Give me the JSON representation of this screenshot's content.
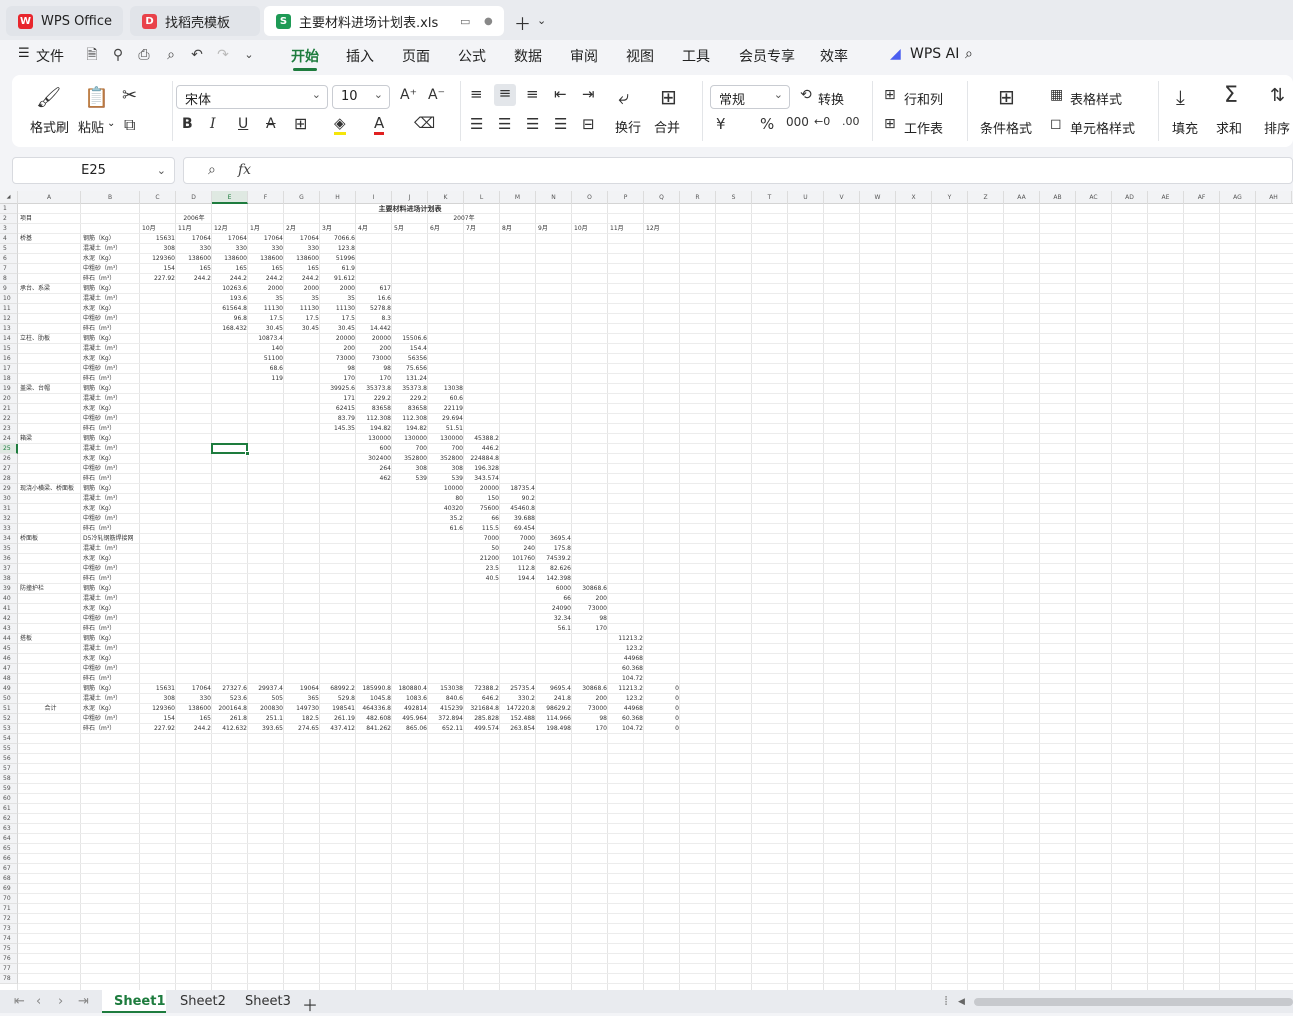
{
  "tabs": {
    "wps": "WPS Office",
    "templates": "找稻壳模板",
    "file": "主要材料进场计划表.xls"
  },
  "menu": {
    "file": "文件",
    "items": [
      "开始",
      "插入",
      "页面",
      "公式",
      "数据",
      "审阅",
      "视图",
      "工具",
      "会员专享",
      "效率"
    ],
    "ai": "WPS AI"
  },
  "ribbon": {
    "format_painter": "格式刷",
    "paste": "粘贴",
    "font": "宋体",
    "size": "10",
    "wrap": "换行",
    "merge": "合并",
    "numfmt": "常规",
    "convert": "转换",
    "rowcol": "行和列",
    "worksheet": "工作表",
    "condfmt": "条件格式",
    "tablestyle": "表格样式",
    "cellstyle": "单元格样式",
    "fill": "填充",
    "sum": "求和",
    "sort": "排序"
  },
  "namebox": "E25",
  "fx": "fx",
  "cols": [
    "A",
    "B",
    "C",
    "D",
    "E",
    "F",
    "G",
    "H",
    "I",
    "J",
    "K",
    "L",
    "M",
    "N",
    "O",
    "P",
    "Q",
    "R",
    "S",
    "T",
    "U",
    "V",
    "W",
    "X",
    "Y",
    "Z",
    "AA",
    "AB",
    "AC",
    "AD",
    "AE",
    "AF",
    "AG",
    "AH"
  ],
  "sheet_title": "主要材料进场计划表",
  "year_headers": [
    "2006年",
    "2007年"
  ],
  "month_headers": [
    "10月",
    "11月",
    "12月",
    "1月",
    "2月",
    "3月",
    "4月",
    "5月",
    "6月",
    "7月",
    "8月",
    "9月",
    "10月",
    "11月",
    "12月"
  ],
  "cells": [
    [
      2,
      "A",
      "项目"
    ],
    [
      4,
      "A",
      "桥基"
    ],
    [
      4,
      "B",
      "钢筋（Kg）"
    ],
    [
      4,
      "C",
      "15631"
    ],
    [
      4,
      "D",
      "17064"
    ],
    [
      4,
      "E",
      "17064"
    ],
    [
      4,
      "F",
      "17064"
    ],
    [
      4,
      "G",
      "17064"
    ],
    [
      4,
      "H",
      "7066.6"
    ],
    [
      5,
      "B",
      "混凝土（m³）"
    ],
    [
      5,
      "C",
      "308"
    ],
    [
      5,
      "D",
      "330"
    ],
    [
      5,
      "E",
      "330"
    ],
    [
      5,
      "F",
      "330"
    ],
    [
      5,
      "G",
      "330"
    ],
    [
      5,
      "H",
      "123.8"
    ],
    [
      6,
      "B",
      "水泥（Kg）"
    ],
    [
      6,
      "C",
      "129360"
    ],
    [
      6,
      "D",
      "138600"
    ],
    [
      6,
      "E",
      "138600"
    ],
    [
      6,
      "F",
      "138600"
    ],
    [
      6,
      "G",
      "138600"
    ],
    [
      6,
      "H",
      "51996"
    ],
    [
      7,
      "B",
      "中粗砂（m³）"
    ],
    [
      7,
      "C",
      "154"
    ],
    [
      7,
      "D",
      "165"
    ],
    [
      7,
      "E",
      "165"
    ],
    [
      7,
      "F",
      "165"
    ],
    [
      7,
      "G",
      "165"
    ],
    [
      7,
      "H",
      "61.9"
    ],
    [
      8,
      "B",
      "碎石（m³）"
    ],
    [
      8,
      "C",
      "227.92"
    ],
    [
      8,
      "D",
      "244.2"
    ],
    [
      8,
      "E",
      "244.2"
    ],
    [
      8,
      "F",
      "244.2"
    ],
    [
      8,
      "G",
      "244.2"
    ],
    [
      8,
      "H",
      "91.612"
    ],
    [
      9,
      "A",
      "承台、系梁"
    ],
    [
      9,
      "B",
      "钢筋（Kg）"
    ],
    [
      9,
      "E",
      "10263.6"
    ],
    [
      9,
      "F",
      "2000"
    ],
    [
      9,
      "G",
      "2000"
    ],
    [
      9,
      "H",
      "2000"
    ],
    [
      9,
      "I",
      "617"
    ],
    [
      10,
      "B",
      "混凝土（m³）"
    ],
    [
      10,
      "E",
      "193.6"
    ],
    [
      10,
      "F",
      "35"
    ],
    [
      10,
      "G",
      "35"
    ],
    [
      10,
      "H",
      "35"
    ],
    [
      10,
      "I",
      "16.6"
    ],
    [
      11,
      "B",
      "水泥（Kg）"
    ],
    [
      11,
      "E",
      "61564.8"
    ],
    [
      11,
      "F",
      "11130"
    ],
    [
      11,
      "G",
      "11130"
    ],
    [
      11,
      "H",
      "11130"
    ],
    [
      11,
      "I",
      "5278.8"
    ],
    [
      12,
      "B",
      "中粗砂（m³）"
    ],
    [
      12,
      "E",
      "96.8"
    ],
    [
      12,
      "F",
      "17.5"
    ],
    [
      12,
      "G",
      "17.5"
    ],
    [
      12,
      "H",
      "17.5"
    ],
    [
      12,
      "I",
      "8.3"
    ],
    [
      13,
      "B",
      "碎石（m³）"
    ],
    [
      13,
      "E",
      "168.432"
    ],
    [
      13,
      "F",
      "30.45"
    ],
    [
      13,
      "G",
      "30.45"
    ],
    [
      13,
      "H",
      "30.45"
    ],
    [
      13,
      "I",
      "14.442"
    ],
    [
      14,
      "A",
      "立柱、肋板"
    ],
    [
      14,
      "B",
      "钢筋（Kg）"
    ],
    [
      14,
      "F",
      "10873.4"
    ],
    [
      14,
      "H",
      "20000"
    ],
    [
      14,
      "I",
      "20000"
    ],
    [
      14,
      "J",
      "15506.6"
    ],
    [
      15,
      "B",
      "混凝土（m³）"
    ],
    [
      15,
      "F",
      "140"
    ],
    [
      15,
      "H",
      "200"
    ],
    [
      15,
      "I",
      "200"
    ],
    [
      15,
      "J",
      "154.4"
    ],
    [
      16,
      "B",
      "水泥（Kg）"
    ],
    [
      16,
      "F",
      "51100"
    ],
    [
      16,
      "H",
      "73000"
    ],
    [
      16,
      "I",
      "73000"
    ],
    [
      16,
      "J",
      "56356"
    ],
    [
      17,
      "B",
      "中粗砂（m³）"
    ],
    [
      17,
      "F",
      "68.6"
    ],
    [
      17,
      "H",
      "98"
    ],
    [
      17,
      "I",
      "98"
    ],
    [
      17,
      "J",
      "75.656"
    ],
    [
      18,
      "B",
      "碎石（m³）"
    ],
    [
      18,
      "F",
      "119"
    ],
    [
      18,
      "H",
      "170"
    ],
    [
      18,
      "I",
      "170"
    ],
    [
      18,
      "J",
      "131.24"
    ],
    [
      19,
      "A",
      "盖梁、台帽"
    ],
    [
      19,
      "B",
      "钢筋（Kg）"
    ],
    [
      19,
      "H",
      "39925.6"
    ],
    [
      19,
      "I",
      "35373.8"
    ],
    [
      19,
      "J",
      "35373.8"
    ],
    [
      19,
      "K",
      "13038"
    ],
    [
      20,
      "B",
      "混凝土（m³）"
    ],
    [
      20,
      "H",
      "171"
    ],
    [
      20,
      "I",
      "229.2"
    ],
    [
      20,
      "J",
      "229.2"
    ],
    [
      20,
      "K",
      "60.6"
    ],
    [
      21,
      "B",
      "水泥（Kg）"
    ],
    [
      21,
      "H",
      "62415"
    ],
    [
      21,
      "I",
      "83658"
    ],
    [
      21,
      "J",
      "83658"
    ],
    [
      21,
      "K",
      "22119"
    ],
    [
      22,
      "B",
      "中粗砂（m³）"
    ],
    [
      22,
      "H",
      "83.79"
    ],
    [
      22,
      "I",
      "112.308"
    ],
    [
      22,
      "J",
      "112.308"
    ],
    [
      22,
      "K",
      "29.694"
    ],
    [
      23,
      "B",
      "碎石（m³）"
    ],
    [
      23,
      "H",
      "145.35"
    ],
    [
      23,
      "I",
      "194.82"
    ],
    [
      23,
      "J",
      "194.82"
    ],
    [
      23,
      "K",
      "51.51"
    ],
    [
      24,
      "A",
      "箱梁"
    ],
    [
      24,
      "B",
      "钢筋（Kg）"
    ],
    [
      24,
      "I",
      "130000"
    ],
    [
      24,
      "J",
      "130000"
    ],
    [
      24,
      "K",
      "130000"
    ],
    [
      24,
      "L",
      "45388.2"
    ],
    [
      25,
      "B",
      "混凝土（m³）"
    ],
    [
      25,
      "I",
      "600"
    ],
    [
      25,
      "J",
      "700"
    ],
    [
      25,
      "K",
      "700"
    ],
    [
      25,
      "L",
      "446.2"
    ],
    [
      26,
      "B",
      "水泥（Kg）"
    ],
    [
      26,
      "I",
      "302400"
    ],
    [
      26,
      "J",
      "352800"
    ],
    [
      26,
      "K",
      "352800"
    ],
    [
      26,
      "L",
      "224884.8"
    ],
    [
      27,
      "B",
      "中粗砂（m³）"
    ],
    [
      27,
      "I",
      "264"
    ],
    [
      27,
      "J",
      "308"
    ],
    [
      27,
      "K",
      "308"
    ],
    [
      27,
      "L",
      "196.328"
    ],
    [
      28,
      "B",
      "碎石（m³）"
    ],
    [
      28,
      "I",
      "462"
    ],
    [
      28,
      "J",
      "539"
    ],
    [
      28,
      "K",
      "539"
    ],
    [
      28,
      "L",
      "343.574"
    ],
    [
      29,
      "A",
      "现浇小横梁、桥面板"
    ],
    [
      29,
      "B",
      "钢筋（Kg）"
    ],
    [
      29,
      "K",
      "10000"
    ],
    [
      29,
      "L",
      "20000"
    ],
    [
      29,
      "M",
      "18735.4"
    ],
    [
      30,
      "B",
      "混凝土（m³）"
    ],
    [
      30,
      "K",
      "80"
    ],
    [
      30,
      "L",
      "150"
    ],
    [
      30,
      "M",
      "90.2"
    ],
    [
      31,
      "B",
      "水泥（Kg）"
    ],
    [
      31,
      "K",
      "40320"
    ],
    [
      31,
      "L",
      "75600"
    ],
    [
      31,
      "M",
      "45460.8"
    ],
    [
      32,
      "B",
      "中粗砂（m³）"
    ],
    [
      32,
      "K",
      "35.2"
    ],
    [
      32,
      "L",
      "66"
    ],
    [
      32,
      "M",
      "39.688"
    ],
    [
      33,
      "B",
      "碎石（m³）"
    ],
    [
      33,
      "K",
      "61.6"
    ],
    [
      33,
      "L",
      "115.5"
    ],
    [
      33,
      "M",
      "69.454"
    ],
    [
      34,
      "A",
      "桥面板"
    ],
    [
      34,
      "B",
      "D5冷轧钢筋焊接网"
    ],
    [
      34,
      "L",
      "7000"
    ],
    [
      34,
      "M",
      "7000"
    ],
    [
      34,
      "N",
      "3695.4"
    ],
    [
      35,
      "B",
      "混凝土（m³）"
    ],
    [
      35,
      "L",
      "50"
    ],
    [
      35,
      "M",
      "240"
    ],
    [
      35,
      "N",
      "175.8"
    ],
    [
      36,
      "B",
      "水泥（Kg）"
    ],
    [
      36,
      "L",
      "21200"
    ],
    [
      36,
      "M",
      "101760"
    ],
    [
      36,
      "N",
      "74539.2"
    ],
    [
      37,
      "B",
      "中粗砂（m³）"
    ],
    [
      37,
      "L",
      "23.5"
    ],
    [
      37,
      "M",
      "112.8"
    ],
    [
      37,
      "N",
      "82.626"
    ],
    [
      38,
      "B",
      "碎石（m³）"
    ],
    [
      38,
      "L",
      "40.5"
    ],
    [
      38,
      "M",
      "194.4"
    ],
    [
      38,
      "N",
      "142.398"
    ],
    [
      39,
      "A",
      "防撞护栏"
    ],
    [
      39,
      "B",
      "钢筋（Kg）"
    ],
    [
      39,
      "N",
      "6000"
    ],
    [
      39,
      "O",
      "30868.6"
    ],
    [
      40,
      "B",
      "混凝土（m³）"
    ],
    [
      40,
      "N",
      "66"
    ],
    [
      40,
      "O",
      "200"
    ],
    [
      41,
      "B",
      "水泥（Kg）"
    ],
    [
      41,
      "N",
      "24090"
    ],
    [
      41,
      "O",
      "73000"
    ],
    [
      42,
      "B",
      "中粗砂（m³）"
    ],
    [
      42,
      "N",
      "32.34"
    ],
    [
      42,
      "O",
      "98"
    ],
    [
      43,
      "B",
      "碎石（m³）"
    ],
    [
      43,
      "N",
      "56.1"
    ],
    [
      43,
      "O",
      "170"
    ],
    [
      44,
      "A",
      "搭板"
    ],
    [
      44,
      "B",
      "钢筋（Kg）"
    ],
    [
      44,
      "P",
      "11213.2"
    ],
    [
      45,
      "B",
      "混凝土（m³）"
    ],
    [
      45,
      "P",
      "123.2"
    ],
    [
      46,
      "B",
      "水泥（Kg）"
    ],
    [
      46,
      "P",
      "44968"
    ],
    [
      47,
      "B",
      "中粗砂（m³）"
    ],
    [
      47,
      "P",
      "60.368"
    ],
    [
      48,
      "B",
      "碎石（m³）"
    ],
    [
      48,
      "P",
      "104.72"
    ],
    [
      49,
      "B",
      "钢筋（Kg）"
    ],
    [
      49,
      "C",
      "15631"
    ],
    [
      49,
      "D",
      "17064"
    ],
    [
      49,
      "E",
      "27327.6"
    ],
    [
      49,
      "F",
      "29937.4"
    ],
    [
      49,
      "G",
      "19064"
    ],
    [
      49,
      "H",
      "68992.2"
    ],
    [
      49,
      "I",
      "185990.8"
    ],
    [
      49,
      "J",
      "180880.4"
    ],
    [
      49,
      "K",
      "153038"
    ],
    [
      49,
      "L",
      "72388.2"
    ],
    [
      49,
      "M",
      "25735.4"
    ],
    [
      49,
      "N",
      "9695.4"
    ],
    [
      49,
      "O",
      "30868.6"
    ],
    [
      49,
      "P",
      "11213.2"
    ],
    [
      49,
      "Q",
      "0"
    ],
    [
      50,
      "B",
      "混凝土（m³）"
    ],
    [
      50,
      "C",
      "308"
    ],
    [
      50,
      "D",
      "330"
    ],
    [
      50,
      "E",
      "523.6"
    ],
    [
      50,
      "F",
      "505"
    ],
    [
      50,
      "G",
      "365"
    ],
    [
      50,
      "H",
      "529.8"
    ],
    [
      50,
      "I",
      "1045.8"
    ],
    [
      50,
      "J",
      "1083.6"
    ],
    [
      50,
      "K",
      "840.6"
    ],
    [
      50,
      "L",
      "646.2"
    ],
    [
      50,
      "M",
      "330.2"
    ],
    [
      50,
      "N",
      "241.8"
    ],
    [
      50,
      "O",
      "200"
    ],
    [
      50,
      "P",
      "123.2"
    ],
    [
      50,
      "Q",
      "0"
    ],
    [
      51,
      "A",
      "合计"
    ],
    [
      51,
      "B",
      "水泥（Kg）"
    ],
    [
      51,
      "C",
      "129360"
    ],
    [
      51,
      "D",
      "138600"
    ],
    [
      51,
      "E",
      "200164.8"
    ],
    [
      51,
      "F",
      "200830"
    ],
    [
      51,
      "G",
      "149730"
    ],
    [
      51,
      "H",
      "198541"
    ],
    [
      51,
      "I",
      "464336.8"
    ],
    [
      51,
      "J",
      "492814"
    ],
    [
      51,
      "K",
      "415239"
    ],
    [
      51,
      "L",
      "321684.8"
    ],
    [
      51,
      "M",
      "147220.8"
    ],
    [
      51,
      "N",
      "98629.2"
    ],
    [
      51,
      "O",
      "73000"
    ],
    [
      51,
      "P",
      "44968"
    ],
    [
      51,
      "Q",
      "0"
    ],
    [
      52,
      "B",
      "中粗砂（m³）"
    ],
    [
      52,
      "C",
      "154"
    ],
    [
      52,
      "D",
      "165"
    ],
    [
      52,
      "E",
      "261.8"
    ],
    [
      52,
      "F",
      "251.1"
    ],
    [
      52,
      "G",
      "182.5"
    ],
    [
      52,
      "H",
      "261.19"
    ],
    [
      52,
      "I",
      "482.608"
    ],
    [
      52,
      "J",
      "495.964"
    ],
    [
      52,
      "K",
      "372.894"
    ],
    [
      52,
      "L",
      "285.828"
    ],
    [
      52,
      "M",
      "152.488"
    ],
    [
      52,
      "N",
      "114.966"
    ],
    [
      52,
      "O",
      "98"
    ],
    [
      52,
      "P",
      "60.368"
    ],
    [
      52,
      "Q",
      "0"
    ],
    [
      53,
      "B",
      "碎石（m³）"
    ],
    [
      53,
      "C",
      "227.92"
    ],
    [
      53,
      "D",
      "244.2"
    ],
    [
      53,
      "E",
      "412.632"
    ],
    [
      53,
      "F",
      "393.65"
    ],
    [
      53,
      "G",
      "274.65"
    ],
    [
      53,
      "H",
      "437.412"
    ],
    [
      53,
      "I",
      "841.262"
    ],
    [
      53,
      "J",
      "865.06"
    ],
    [
      53,
      "K",
      "652.11"
    ],
    [
      53,
      "L",
      "499.574"
    ],
    [
      53,
      "M",
      "263.854"
    ],
    [
      53,
      "N",
      "198.498"
    ],
    [
      53,
      "O",
      "170"
    ],
    [
      53,
      "P",
      "104.72"
    ],
    [
      53,
      "Q",
      "0"
    ]
  ],
  "sheets": [
    "Sheet1",
    "Sheet2",
    "Sheet3"
  ],
  "active_sheet": "Sheet1",
  "colors": {
    "accent": "#1e7c3e",
    "selection": "#1e7c3e"
  }
}
